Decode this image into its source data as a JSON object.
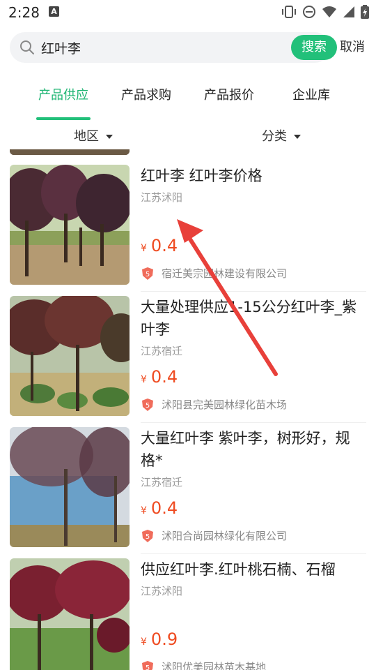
{
  "status_bar": {
    "time": "2:28",
    "notification_letter": "A"
  },
  "search": {
    "value": "红叶李",
    "button_label": "搜索",
    "cancel_label": "取消"
  },
  "tabs": [
    {
      "label": "产品供应",
      "active": true
    },
    {
      "label": "产品求购",
      "active": false
    },
    {
      "label": "产品报价",
      "active": false
    },
    {
      "label": "企业库",
      "active": false
    }
  ],
  "filters": {
    "region": "地区",
    "category": "分类"
  },
  "colors": {
    "accent": "#22c07a",
    "price": "#ef4b21",
    "badge": "#f06c5b"
  },
  "currency_symbol": "¥",
  "items": [
    {
      "title": "红叶李 红叶李价格",
      "location": "江苏沭阳",
      "price": "0.4",
      "company": "宿迁美宗园林建设有限公司",
      "badge": "5"
    },
    {
      "title": "大量处理供应1-15公分红叶李_紫叶李",
      "location": "江苏宿迁",
      "price": "0.4",
      "company": "沭阳县完美园林绿化苗木场",
      "badge": "5"
    },
    {
      "title": "大量红叶李 紫叶李，树形好，规格*",
      "location": "江苏宿迁",
      "price": "0.4",
      "company": "沭阳合尚园林绿化有限公司",
      "badge": "5"
    },
    {
      "title": "供应红叶李.红叶桃石楠、石榴",
      "location": "江苏沭阳",
      "price": "0.9",
      "company": "沭阳优美园林苗木基地",
      "badge": "5"
    }
  ]
}
